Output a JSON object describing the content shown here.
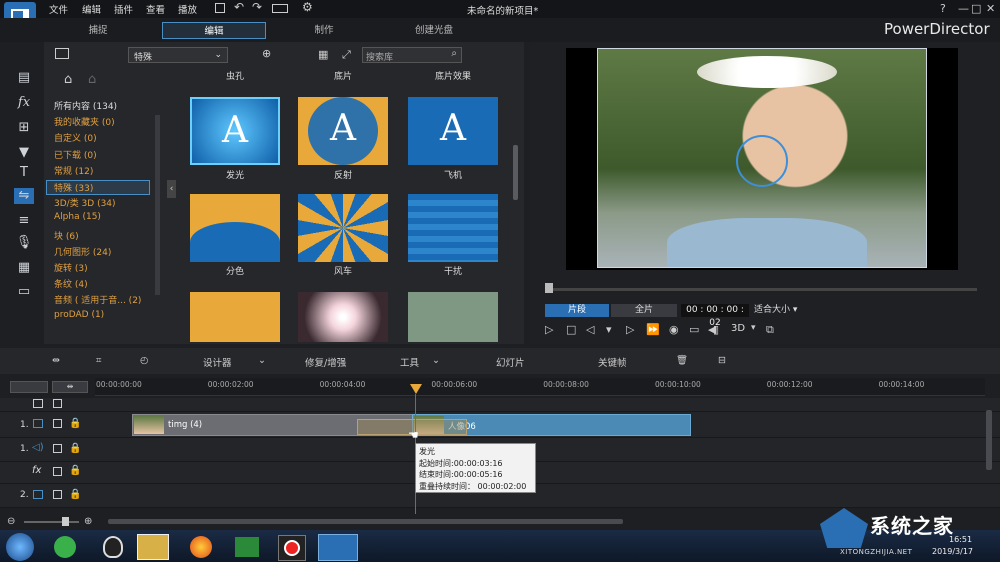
{
  "window": {
    "title": "未命名的新项目*",
    "brand": "PowerDirector",
    "help": "?"
  },
  "menu": [
    "文件",
    "编辑",
    "插件",
    "查看",
    "播放"
  ],
  "modes": [
    "捕捉",
    "编辑",
    "制作",
    "创建光盘"
  ],
  "library": {
    "filter": "特殊",
    "search_placeholder": "搜索库",
    "categories": [
      {
        "label": "所有内容 (134)",
        "color": "#dddddd"
      },
      {
        "label": "我的收藏夹 (0)",
        "color": "#e0a040"
      },
      {
        "label": "自定义 (0)",
        "color": "#e0a040"
      },
      {
        "label": "已下载 (0)",
        "color": "#e0a040"
      },
      {
        "label": "常规 (12)",
        "color": "#e0a040"
      },
      {
        "label": "特殊 (33)",
        "color": "#e0a040"
      },
      {
        "label": "3D/类 3D (34)",
        "color": "#e0a040"
      },
      {
        "label": "Alpha (15)",
        "color": "#e0a040"
      },
      {
        "label": "块 (6)",
        "color": "#e0a040"
      },
      {
        "label": "几何图形 (24)",
        "color": "#e0a040"
      },
      {
        "label": "旋转 (3)",
        "color": "#e0a040"
      },
      {
        "label": "条纹 (4)",
        "color": "#e0a040"
      },
      {
        "label": "音频 ( 适用于音... (2)",
        "color": "#e0a040"
      },
      {
        "label": "proDAD (1)",
        "color": "#e0a040"
      }
    ],
    "top_labels": [
      "虫孔",
      "底片",
      "底片效果"
    ],
    "items": [
      "发光",
      "反射",
      "飞机",
      "分色",
      "风车",
      "干扰"
    ]
  },
  "preview": {
    "tab_clip": "片段",
    "tab_movie": "全片",
    "timecode": "00 : 00 : 00 : 02",
    "fit": "适合大小",
    "mode3d": "3D"
  },
  "edit_toolbar": {
    "designer": "设计器",
    "fix": "修复/增强",
    "tools": "工具",
    "slideshow": "幻灯片",
    "keyframe": "关键帧"
  },
  "ruler": [
    "00:00:00:00",
    "00:00:02:00",
    "00:00:04:00",
    "00:00:06:00",
    "00:00:08:00",
    "00:00:10:00",
    "00:00:12:00",
    "00:00:14:00"
  ],
  "tracks": {
    "track1_label": "1.",
    "track2_label": "2.",
    "fx_label": "fx",
    "clip_a": "timg (4)",
    "clip_b": "人像06"
  },
  "tooltip": {
    "title": "发光",
    "start": "起始时间:00:00:03:16",
    "end": "结束时间:00:00:05:16",
    "overlap": "重叠持续时间： 00:00:02:00"
  },
  "taskbar": {
    "time": "16:51",
    "date": "2019/3/17"
  },
  "watermark": {
    "line1": "系统之家",
    "line2": "XITONGZHIJIA.NET"
  }
}
